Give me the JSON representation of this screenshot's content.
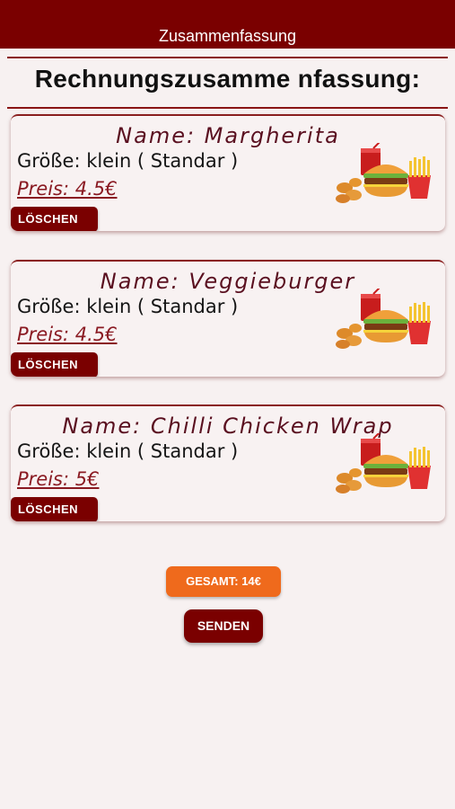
{
  "header": {
    "title": "Zusammenfassung"
  },
  "page": {
    "title": "Rechnungszusamme nfassung:"
  },
  "items": [
    {
      "name": "Name: Margherita",
      "size": "Größe: klein ( Standar )",
      "price": "Preis: 4.5€",
      "delete_label": "LÖSCHEN",
      "image": "food-combo-icon"
    },
    {
      "name": "Name: Veggieburger",
      "size": "Größe: klein ( Standar )",
      "price": "Preis: 4.5€",
      "delete_label": "LÖSCHEN",
      "image": "food-combo-icon"
    },
    {
      "name": "Name: Chilli Chicken Wrap",
      "size": "Größe: klein ( Standar )",
      "price": "Preis: 5€",
      "delete_label": "LÖSCHEN",
      "image": "food-combo-icon"
    }
  ],
  "summary": {
    "total_label": "GESAMT: 14€",
    "send_label": "SENDEN"
  },
  "colors": {
    "primary": "#7a0000",
    "accent": "#ef6a1c",
    "background": "#f7f1f1"
  }
}
